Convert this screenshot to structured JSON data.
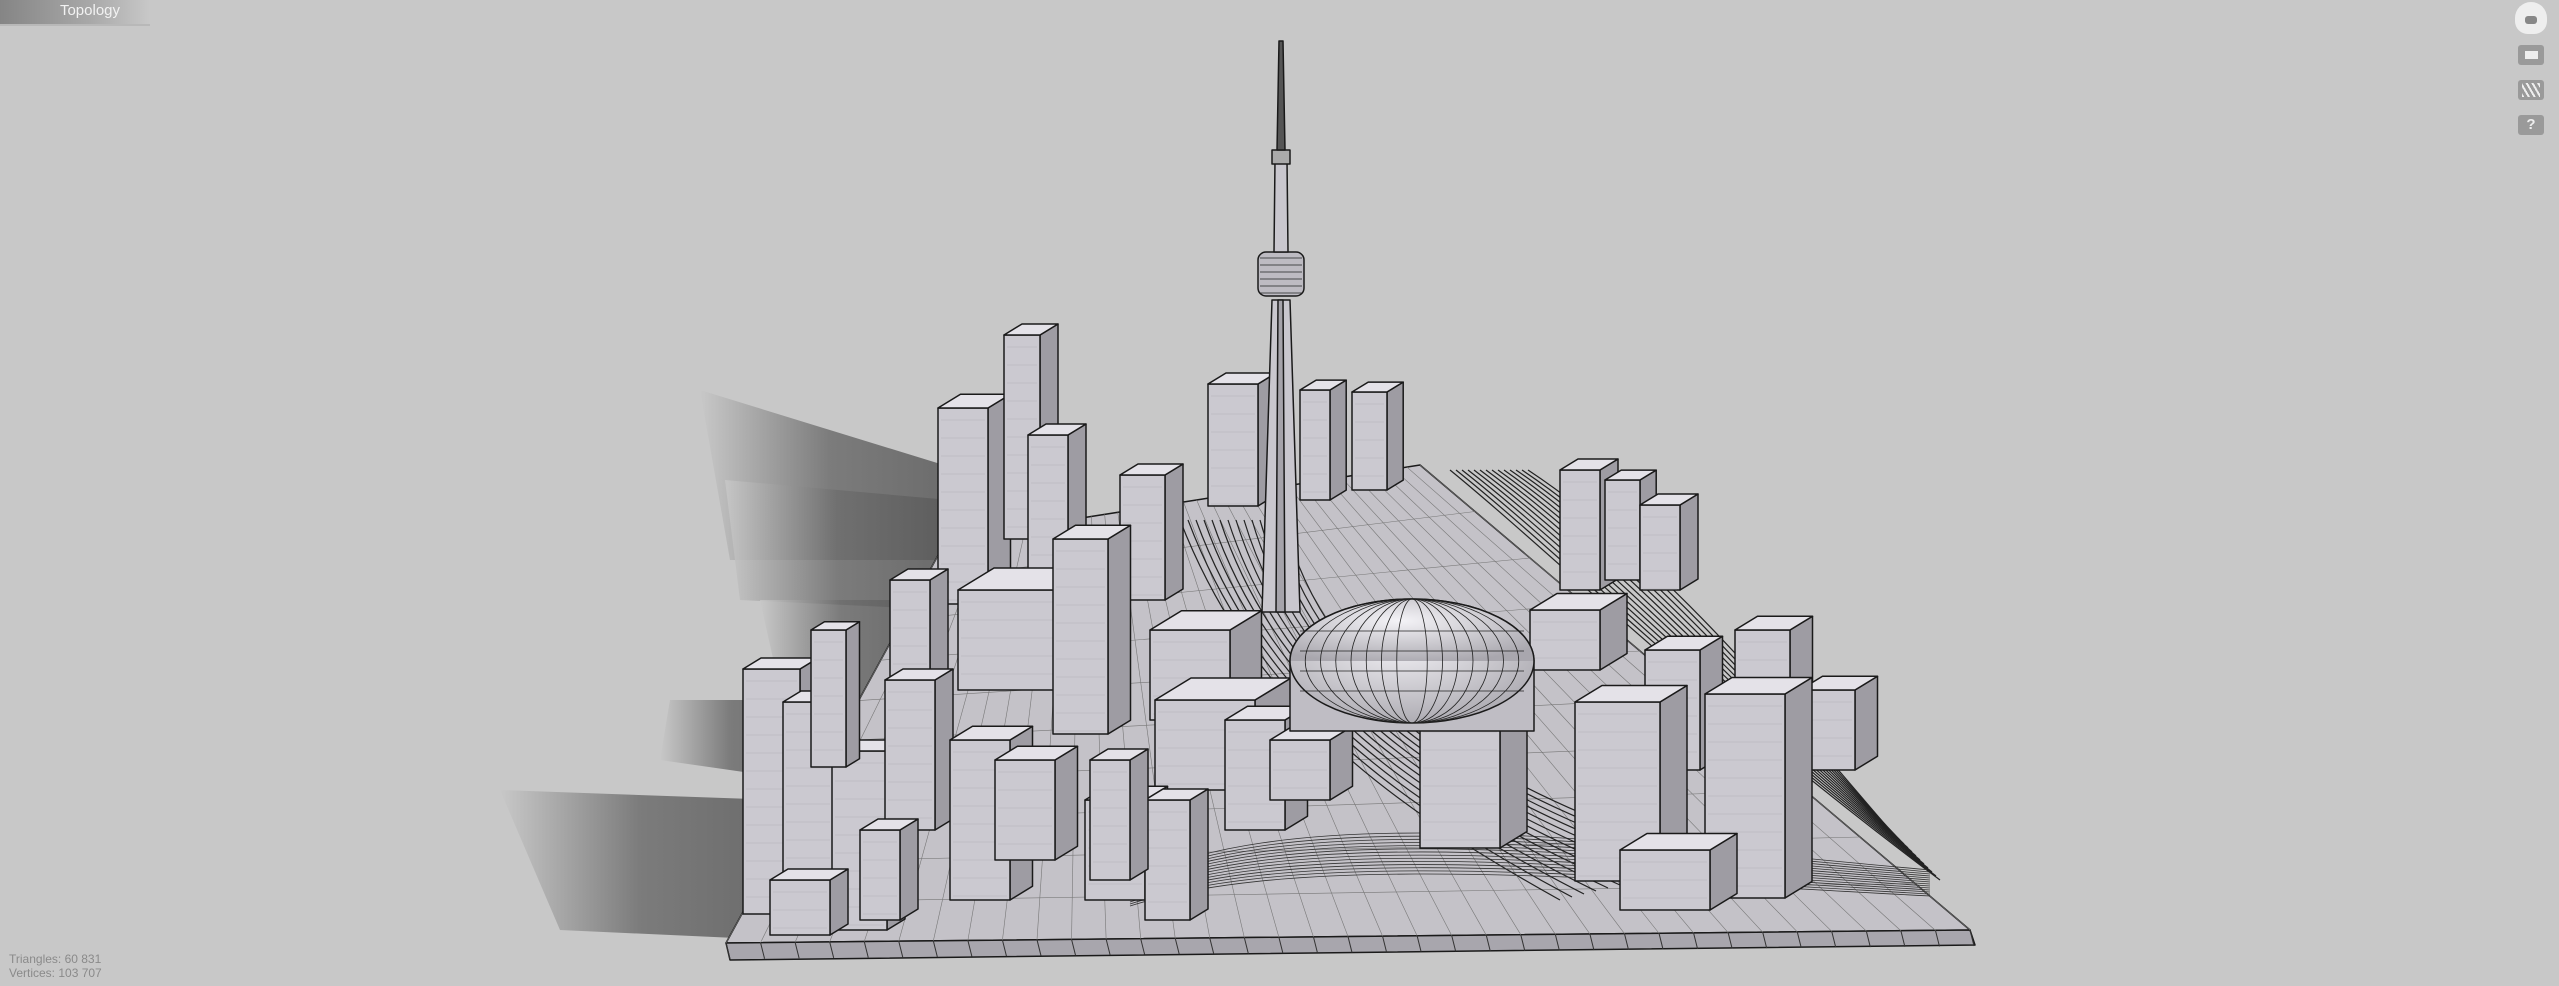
{
  "window": {
    "tab_title": "Topology"
  },
  "toolbar": {
    "items": [
      {
        "name": "home-view",
        "icon": "home-head-icon"
      },
      {
        "name": "display-mode",
        "icon": "rectangle-icon"
      },
      {
        "name": "wireframe-mode",
        "icon": "hatch-lines-icon"
      },
      {
        "name": "help",
        "icon": "question-icon",
        "label": "?"
      }
    ]
  },
  "stats": {
    "triangles_label": "Triangles: 60 831",
    "vertices_label": "Vertices: 103 707"
  },
  "colors": {
    "background": "#c8c8c8",
    "model_face": "#cbc9d0",
    "edges": "#1a1a1a"
  }
}
